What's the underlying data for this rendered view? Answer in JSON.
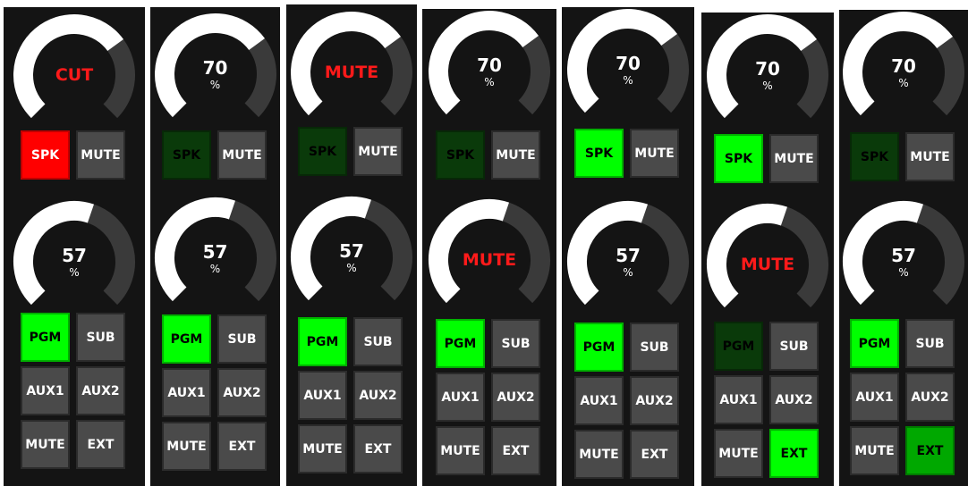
{
  "colors": {
    "panel_bg": "#141414",
    "gauge_track": "#3a3a3a",
    "gauge_fill": "#ffffff",
    "label_red": "#ff1a1a",
    "button_gray": "#4a4a4a",
    "button_active_green": "#00ff00",
    "button_dark_green": "#0a3a0a",
    "button_red": "#ff0000"
  },
  "strips": [
    {
      "gauge_top": {
        "text": "CUT",
        "unit": "",
        "red": true,
        "level": 0.7
      },
      "top_buttons": [
        {
          "label": "SPK",
          "state": "red"
        },
        {
          "label": "MUTE",
          "state": "gray"
        }
      ],
      "gauge_bottom": {
        "text": "57",
        "unit": "%",
        "red": false,
        "level": 0.57
      },
      "bottom_buttons": [
        {
          "label": "PGM",
          "state": "green"
        },
        {
          "label": "SUB",
          "state": "gray"
        },
        {
          "label": "AUX1",
          "state": "gray"
        },
        {
          "label": "AUX2",
          "state": "gray"
        },
        {
          "label": "MUTE",
          "state": "gray"
        },
        {
          "label": "EXT",
          "state": "gray"
        }
      ]
    },
    {
      "gauge_top": {
        "text": "70",
        "unit": "%",
        "red": false,
        "level": 0.7
      },
      "top_buttons": [
        {
          "label": "SPK",
          "state": "dark"
        },
        {
          "label": "MUTE",
          "state": "gray"
        }
      ],
      "gauge_bottom": {
        "text": "57",
        "unit": "%",
        "red": false,
        "level": 0.57
      },
      "bottom_buttons": [
        {
          "label": "PGM",
          "state": "green"
        },
        {
          "label": "SUB",
          "state": "gray"
        },
        {
          "label": "AUX1",
          "state": "gray"
        },
        {
          "label": "AUX2",
          "state": "gray"
        },
        {
          "label": "MUTE",
          "state": "gray"
        },
        {
          "label": "EXT",
          "state": "gray"
        }
      ]
    },
    {
      "gauge_top": {
        "text": "MUTE",
        "unit": "",
        "red": true,
        "level": 0.7
      },
      "top_buttons": [
        {
          "label": "SPK",
          "state": "dark"
        },
        {
          "label": "MUTE",
          "state": "gray"
        }
      ],
      "gauge_bottom": {
        "text": "57",
        "unit": "%",
        "red": false,
        "level": 0.57
      },
      "bottom_buttons": [
        {
          "label": "PGM",
          "state": "green"
        },
        {
          "label": "SUB",
          "state": "gray"
        },
        {
          "label": "AUX1",
          "state": "gray"
        },
        {
          "label": "AUX2",
          "state": "gray"
        },
        {
          "label": "MUTE",
          "state": "gray"
        },
        {
          "label": "EXT",
          "state": "gray"
        }
      ]
    },
    {
      "gauge_top": {
        "text": "70",
        "unit": "%",
        "red": false,
        "level": 0.7
      },
      "top_buttons": [
        {
          "label": "SPK",
          "state": "dark"
        },
        {
          "label": "MUTE",
          "state": "gray"
        }
      ],
      "gauge_bottom": {
        "text": "MUTE",
        "unit": "",
        "red": true,
        "level": 0.57
      },
      "bottom_buttons": [
        {
          "label": "PGM",
          "state": "green"
        },
        {
          "label": "SUB",
          "state": "gray"
        },
        {
          "label": "AUX1",
          "state": "gray"
        },
        {
          "label": "AUX2",
          "state": "gray"
        },
        {
          "label": "MUTE",
          "state": "gray"
        },
        {
          "label": "EXT",
          "state": "gray"
        }
      ]
    },
    {
      "gauge_top": {
        "text": "70",
        "unit": "%",
        "red": false,
        "level": 0.7
      },
      "top_buttons": [
        {
          "label": "SPK",
          "state": "green"
        },
        {
          "label": "MUTE",
          "state": "gray"
        }
      ],
      "gauge_bottom": {
        "text": "57",
        "unit": "%",
        "red": false,
        "level": 0.57
      },
      "bottom_buttons": [
        {
          "label": "PGM",
          "state": "green"
        },
        {
          "label": "SUB",
          "state": "gray"
        },
        {
          "label": "AUX1",
          "state": "gray"
        },
        {
          "label": "AUX2",
          "state": "gray"
        },
        {
          "label": "MUTE",
          "state": "gray"
        },
        {
          "label": "EXT",
          "state": "gray"
        }
      ]
    },
    {
      "gauge_top": {
        "text": "70",
        "unit": "%",
        "red": false,
        "level": 0.7
      },
      "top_buttons": [
        {
          "label": "SPK",
          "state": "green"
        },
        {
          "label": "MUTE",
          "state": "gray"
        }
      ],
      "gauge_bottom": {
        "text": "MUTE",
        "unit": "",
        "red": true,
        "level": 0.57
      },
      "bottom_buttons": [
        {
          "label": "PGM",
          "state": "dark"
        },
        {
          "label": "SUB",
          "state": "gray"
        },
        {
          "label": "AUX1",
          "state": "gray"
        },
        {
          "label": "AUX2",
          "state": "gray"
        },
        {
          "label": "MUTE",
          "state": "gray"
        },
        {
          "label": "EXT",
          "state": "green"
        }
      ]
    },
    {
      "gauge_top": {
        "text": "70",
        "unit": "%",
        "red": false,
        "level": 0.7
      },
      "top_buttons": [
        {
          "label": "SPK",
          "state": "dark"
        },
        {
          "label": "MUTE",
          "state": "gray"
        }
      ],
      "gauge_bottom": {
        "text": "57",
        "unit": "%",
        "red": false,
        "level": 0.57
      },
      "bottom_buttons": [
        {
          "label": "PGM",
          "state": "green"
        },
        {
          "label": "SUB",
          "state": "gray"
        },
        {
          "label": "AUX1",
          "state": "gray"
        },
        {
          "label": "AUX2",
          "state": "gray"
        },
        {
          "label": "MUTE",
          "state": "gray"
        },
        {
          "label": "EXT",
          "state": "midgreen"
        }
      ]
    }
  ]
}
